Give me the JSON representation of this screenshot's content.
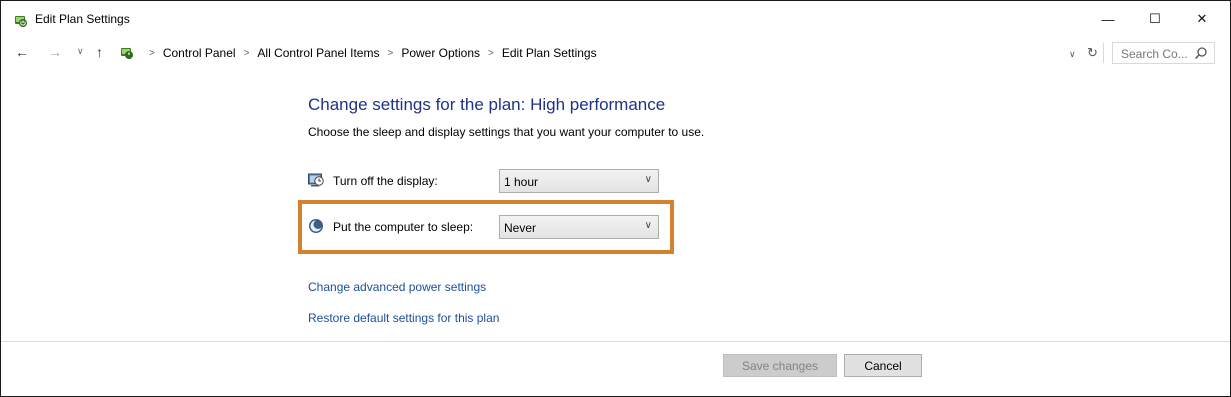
{
  "window": {
    "title": "Edit Plan Settings",
    "controls": {
      "minimize": "—",
      "maximize": "☐",
      "close": "✕"
    }
  },
  "address_bar": {
    "crumbs": [
      "Control Panel",
      "All Control Panel Items",
      "Power Options",
      "Edit Plan Settings"
    ],
    "search_placeholder": "Search Co..."
  },
  "main": {
    "title": "Change settings for the plan: High performance",
    "description": "Choose the sleep and display settings that you want your computer to use.",
    "settings": [
      {
        "label": "Turn off the display:",
        "value": "1 hour",
        "icon": "display-icon"
      },
      {
        "label": "Put the computer to sleep:",
        "value": "Never",
        "icon": "moon-icon"
      }
    ],
    "links": [
      "Change advanced power settings",
      "Restore default settings for this plan"
    ],
    "highlight_color": "#d4822e"
  },
  "footer": {
    "save_label": "Save changes",
    "cancel_label": "Cancel"
  }
}
